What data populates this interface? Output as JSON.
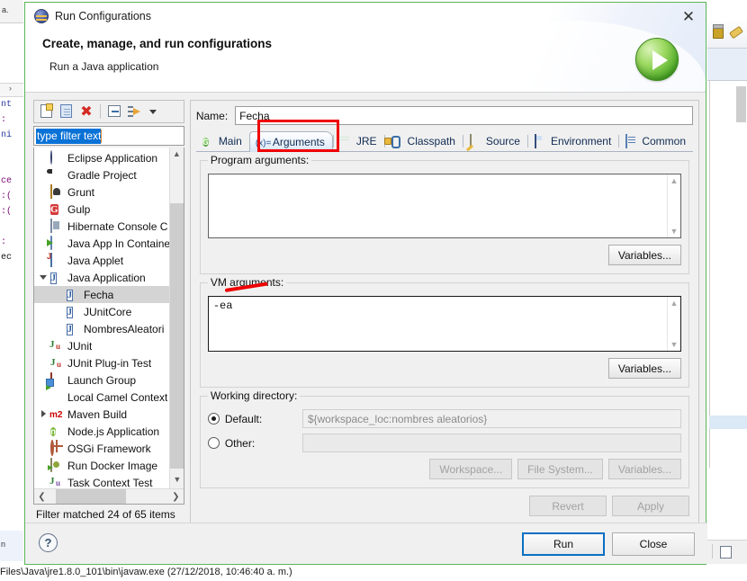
{
  "window": {
    "title": "Run Configurations",
    "title_icon": "eclipse-icon",
    "close_label": "✕",
    "heading": "Create, manage, and run configurations",
    "subheading": "Run a Java application",
    "banner_icon": "run-green-arrow-icon"
  },
  "tree_toolbar": {
    "new_label": "new-configuration-icon",
    "duplicate_label": "duplicate-configuration-icon",
    "delete_label": "✖",
    "collapse_label": "collapse-all-icon",
    "filter_label": "filter-icon",
    "menu_label": "▼"
  },
  "filter": {
    "value": "type filter text",
    "placeholder": "type filter text",
    "status": "Filter matched 24 of 65 items"
  },
  "tree": {
    "items": [
      {
        "label": "Eclipse Application",
        "icon": "eclipse-icon",
        "indent": 0,
        "twisty": "none",
        "selected": false
      },
      {
        "label": "Gradle Project",
        "icon": "gradle-icon",
        "indent": 0,
        "twisty": "none",
        "selected": false
      },
      {
        "label": "Grunt",
        "icon": "grunt-icon",
        "indent": 0,
        "twisty": "none",
        "selected": false
      },
      {
        "label": "Gulp",
        "icon": "gulp-icon",
        "indent": 0,
        "twisty": "none",
        "selected": false
      },
      {
        "label": "Hibernate Console C",
        "icon": "hibernate-icon",
        "indent": 0,
        "twisty": "none",
        "selected": false
      },
      {
        "label": "Java App In Containe",
        "icon": "container-icon",
        "indent": 0,
        "twisty": "none",
        "selected": false
      },
      {
        "label": "Java Applet",
        "icon": "applet-icon",
        "indent": 0,
        "twisty": "none",
        "selected": false
      },
      {
        "label": "Java Application",
        "icon": "java-application-icon",
        "indent": 0,
        "twisty": "expanded",
        "selected": false
      },
      {
        "label": "Fecha",
        "icon": "java-application-icon",
        "indent": 1,
        "twisty": "none",
        "selected": true
      },
      {
        "label": "JUnitCore",
        "icon": "java-application-icon",
        "indent": 1,
        "twisty": "none",
        "selected": false
      },
      {
        "label": "NombresAleatori",
        "icon": "java-application-icon",
        "indent": 1,
        "twisty": "none",
        "selected": false
      },
      {
        "label": "JUnit",
        "icon": "junit-icon",
        "indent": 0,
        "twisty": "none",
        "selected": false
      },
      {
        "label": "JUnit Plug-in Test",
        "icon": "junit-plugin-icon",
        "indent": 0,
        "twisty": "none",
        "selected": false
      },
      {
        "label": "Launch Group",
        "icon": "launch-group-icon",
        "indent": 0,
        "twisty": "none",
        "selected": false
      },
      {
        "label": "Local Camel Context",
        "icon": "camel-icon",
        "indent": 0,
        "twisty": "none",
        "selected": false
      },
      {
        "label": "Maven Build",
        "icon": "maven-icon",
        "indent": 0,
        "twisty": "collapsed",
        "selected": false
      },
      {
        "label": "Node.js Application",
        "icon": "nodejs-icon",
        "indent": 0,
        "twisty": "none",
        "selected": false
      },
      {
        "label": "OSGi Framework",
        "icon": "osgi-icon",
        "indent": 0,
        "twisty": "none",
        "selected": false
      },
      {
        "label": "Run Docker Image",
        "icon": "docker-icon",
        "indent": 0,
        "twisty": "none",
        "selected": false
      },
      {
        "label": "Task Context Test",
        "icon": "task-context-icon",
        "indent": 0,
        "twisty": "none",
        "selected": false
      }
    ],
    "maven_badge": "m2",
    "node_badge": "n",
    "gulp_badge": "G",
    "java_badge": "J"
  },
  "config": {
    "name_label": "Name:",
    "name_value": "Fecha",
    "tabs": [
      {
        "label": "Main",
        "icon": "main-tab-icon",
        "active": false
      },
      {
        "label": "Arguments",
        "icon": "arguments-tab-icon",
        "active": true
      },
      {
        "label": "JRE",
        "icon": "jre-tab-icon",
        "active": false
      },
      {
        "label": "Classpath",
        "icon": "classpath-tab-icon",
        "active": false
      },
      {
        "label": "Source",
        "icon": "source-tab-icon",
        "active": false
      },
      {
        "label": "Environment",
        "icon": "environment-tab-icon",
        "active": false
      },
      {
        "label": "Common",
        "icon": "common-tab-icon",
        "active": false
      }
    ],
    "arguments_tab_prefix": "(x)=",
    "program_arguments": {
      "label": "Program arguments:",
      "value": "",
      "variables_label": "Variables..."
    },
    "vm_arguments": {
      "label": "VM arguments:",
      "value": "-ea",
      "variables_label": "Variables..."
    },
    "working_directory": {
      "label": "Working directory:",
      "default_label": "Default:",
      "default_value": "${workspace_loc:nombres aleatorios}",
      "default_selected": true,
      "other_label": "Other:",
      "other_value": "",
      "workspace_label": "Workspace...",
      "filesystem_label": "File System...",
      "variables_label": "Variables..."
    },
    "revert_label": "Revert",
    "apply_label": "Apply"
  },
  "footer": {
    "help_label": "?",
    "run_label": "Run",
    "close_label": "Close"
  },
  "background": {
    "tab_label": "a.",
    "status_text": "Files\\Java\\jre1.8.0_101\\bin\\javaw.exe (27/12/2018, 10:46:40 a. m.)",
    "code_lines": [
      "nt",
      ":",
      "ni",
      "ce",
      ":(",
      ":(",
      ":",
      "ec"
    ],
    "left_label": "n"
  },
  "annotations": {
    "tab_highlight": "red-rectangle-around-arguments-tab",
    "vm_underline": "red-underline-under-ea",
    "color": "#ee0000"
  }
}
